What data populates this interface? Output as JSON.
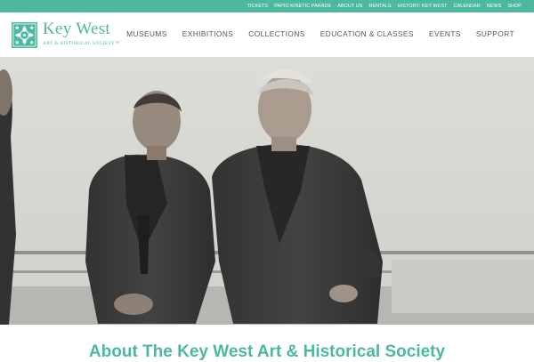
{
  "utility_nav": {
    "items": [
      {
        "label": "TICKETS"
      },
      {
        "label": "PAPIO KINETIC PARADE"
      },
      {
        "label": "ABOUT US"
      },
      {
        "label": "RENTALS"
      },
      {
        "label": "HISTORY: KEY WEST"
      },
      {
        "label": "CALENDAR"
      },
      {
        "label": "NEWS"
      },
      {
        "label": "SHOP"
      }
    ]
  },
  "logo": {
    "name": "Key West",
    "tagline": "ART & HISTORICAL SOCIETY™"
  },
  "main_nav": {
    "items": [
      {
        "label": "MUSEUMS"
      },
      {
        "label": "EXHIBITIONS"
      },
      {
        "label": "COLLECTIONS"
      },
      {
        "label": "EDUCATION & CLASSES"
      },
      {
        "label": "EVENTS"
      },
      {
        "label": "SUPPORT"
      }
    ]
  },
  "hero": {
    "image": "black-and-white-photo-two-sailors",
    "slide_count": 3,
    "active_slide": 1
  },
  "about": {
    "title": "About The Key West Art & Historical Society"
  },
  "colors": {
    "accent": "#4db8a0",
    "nav_text": "#555555",
    "utility_bg": "#4db8a0"
  }
}
